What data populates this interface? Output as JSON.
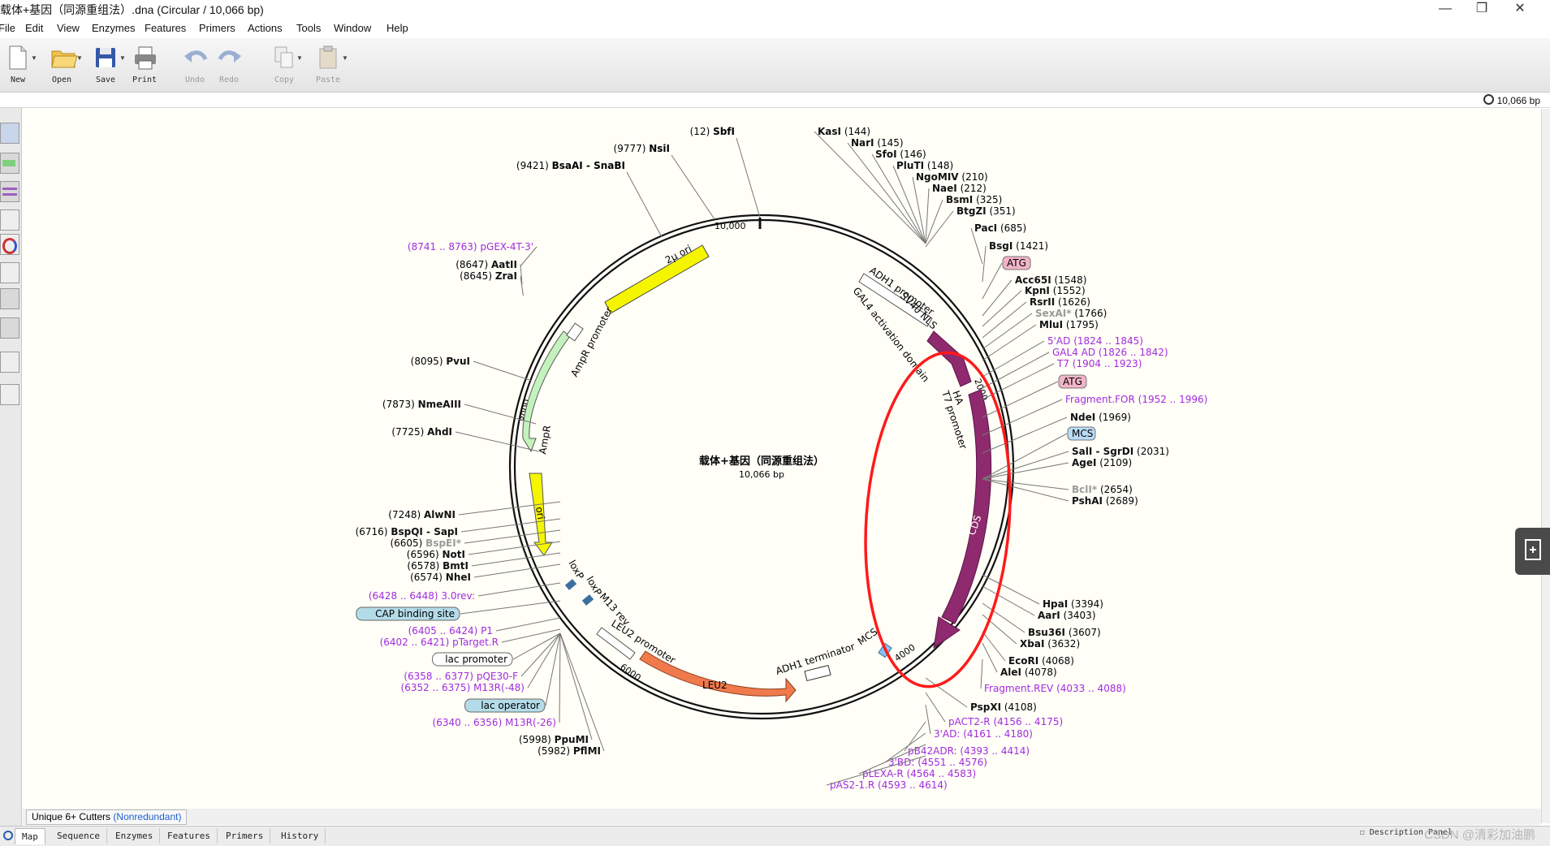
{
  "window": {
    "title": "载体+基因（同源重组法）.dna  (Circular / 10,066 bp)",
    "minimize": "—",
    "maximize": "❐",
    "close": "✕"
  },
  "menu": [
    "File",
    "Edit",
    "View",
    "Enzymes",
    "Features",
    "Primers",
    "Actions",
    "Tools",
    "Window",
    "Help"
  ],
  "toolbar": {
    "new": "New",
    "open": "Open",
    "save": "Save",
    "print": "Print",
    "undo": "Undo",
    "redo": "Redo",
    "copy": "Copy",
    "paste": "Paste"
  },
  "status": {
    "length": "10,066 bp"
  },
  "map": {
    "name": "载体+基因（同源重组法）",
    "length": "10,066 bp",
    "ticks": [
      "10,000",
      "2000",
      "4000",
      "6000",
      "8000"
    ],
    "features": [
      "2μ ori",
      "ADH1 promoter",
      "SV40 NLS",
      "GAL4 activation domain",
      "HA",
      "T7 promoter",
      "CDS",
      "MCS",
      "ADH1 terminator",
      "LEU2",
      "LEU2 promoter",
      "M13 rev",
      "loxP",
      "loxP",
      "ori",
      "AmpR",
      "AmpR promoter"
    ],
    "sites_top": [
      {
        "pos": "(12)",
        "name": "SbfI"
      },
      {
        "pos": "(9777)",
        "name": "NsiI"
      },
      {
        "pos": "(9421)",
        "name": "BsaAI - SnaBI"
      }
    ],
    "sites_right": [
      {
        "name": "KasI",
        "pos": "(144)"
      },
      {
        "name": "NarI",
        "pos": "(145)"
      },
      {
        "name": "SfoI",
        "pos": "(146)"
      },
      {
        "name": "PluTI",
        "pos": "(148)"
      },
      {
        "name": "NgoMIV",
        "pos": "(210)"
      },
      {
        "name": "NaeI",
        "pos": "(212)"
      },
      {
        "name": "BsmI",
        "pos": "(325)"
      },
      {
        "name": "BtgZI",
        "pos": "(351)"
      },
      {
        "name": "PacI",
        "pos": "(685)"
      },
      {
        "name": "BsgI",
        "pos": "(1421)"
      },
      {
        "name": "Acc65I",
        "pos": "(1548)"
      },
      {
        "name": "KpnI",
        "pos": "(1552)"
      },
      {
        "name": "RsrII",
        "pos": "(1626)"
      },
      {
        "name": "SexAI*",
        "pos": "(1766)"
      },
      {
        "name": "MluI",
        "pos": "(1795)"
      },
      {
        "name": "NdeI",
        "pos": "(1969)"
      },
      {
        "name": "SalI - SgrDI",
        "pos": "(2031)"
      },
      {
        "name": "AgeI",
        "pos": "(2109)"
      },
      {
        "name": "BclI*",
        "pos": "(2654)"
      },
      {
        "name": "PshAI",
        "pos": "(2689)"
      },
      {
        "name": "HpaI",
        "pos": "(3394)"
      },
      {
        "name": "AarI",
        "pos": "(3403)"
      },
      {
        "name": "Bsu36I",
        "pos": "(3607)"
      },
      {
        "name": "XbaI",
        "pos": "(3632)"
      },
      {
        "name": "EcoRI",
        "pos": "(4068)"
      },
      {
        "name": "AleI",
        "pos": "(4078)"
      },
      {
        "name": "PspXI",
        "pos": "(4108)"
      }
    ],
    "primers_right": [
      {
        "name": "5'AD",
        "range": "(1824 .. 1845)"
      },
      {
        "name": "GAL4 AD",
        "range": "(1826 .. 1842)"
      },
      {
        "name": "T7",
        "range": "(1904 .. 1923)"
      },
      {
        "name": "Fragment.FOR",
        "range": "(1952 .. 1996)"
      },
      {
        "name": "Fragment.REV",
        "range": "(4033 .. 4088)"
      },
      {
        "name": "pACT2-R",
        "range": "(4156 .. 4175)"
      },
      {
        "name": "3'AD:",
        "range": "(4161 .. 4180)"
      },
      {
        "name": "pB42ADR:",
        "range": "(4393 .. 4414)"
      },
      {
        "name": "3'BD:",
        "range": "(4551 .. 4576)"
      },
      {
        "name": "pLEXA-R",
        "range": "(4564 .. 4583)"
      },
      {
        "name": "pAS2-1.R",
        "range": "(4593 .. 4614)"
      }
    ],
    "boxed_right": [
      "ATG",
      "ATG",
      "MCS"
    ],
    "sites_left": [
      {
        "pos": "(8647)",
        "name": "AatII"
      },
      {
        "pos": "(8645)",
        "name": "ZraI"
      },
      {
        "pos": "(8095)",
        "name": "PvuI"
      },
      {
        "pos": "(7873)",
        "name": "NmeAIII"
      },
      {
        "pos": "(7725)",
        "name": "AhdI"
      },
      {
        "pos": "(7248)",
        "name": "AlwNI"
      },
      {
        "pos": "(6716)",
        "name": "BspQI - SapI"
      },
      {
        "pos": "(6605)",
        "name": "BspEI*"
      },
      {
        "pos": "(6596)",
        "name": "NotI"
      },
      {
        "pos": "(6578)",
        "name": "BmtI"
      },
      {
        "pos": "(6574)",
        "name": "NheI"
      },
      {
        "pos": "(5998)",
        "name": "PpuMI"
      },
      {
        "pos": "(5982)",
        "name": "PflMI"
      }
    ],
    "primers_left": [
      {
        "range": "(8741 .. 8763)",
        "name": "pGEX-4T-3'"
      },
      {
        "range": "(6428 .. 6448)",
        "name": "3.0rev:"
      },
      {
        "range": "(6405 .. 6424)",
        "name": "P1"
      },
      {
        "range": "(6402 .. 6421)",
        "name": "pTarget.R"
      },
      {
        "range": "(6358 .. 6377)",
        "name": "pQE30-F"
      },
      {
        "range": "(6352 .. 6375)",
        "name": "M13R(-48)"
      },
      {
        "range": "(6340 .. 6356)",
        "name": "M13R(-26)"
      }
    ],
    "boxed_left": [
      "CAP binding site",
      "lac promoter",
      "lac operator"
    ]
  },
  "cutter": {
    "label": "Unique 6+ Cutters",
    "mode": "(Nonredundant)"
  },
  "tabs": [
    "Map",
    "Sequence",
    "Enzymes",
    "Features",
    "Primers",
    "History"
  ],
  "description": "Description Panel",
  "watermark": "CSDN @清彩加油鹏",
  "colors": {
    "yellow": "#f5f500",
    "green": "#c4f2bd",
    "purple": "#8f2a6e",
    "orange": "#f07a4c",
    "primer": "#a02ce0",
    "highlight": "#ff1a1a"
  }
}
